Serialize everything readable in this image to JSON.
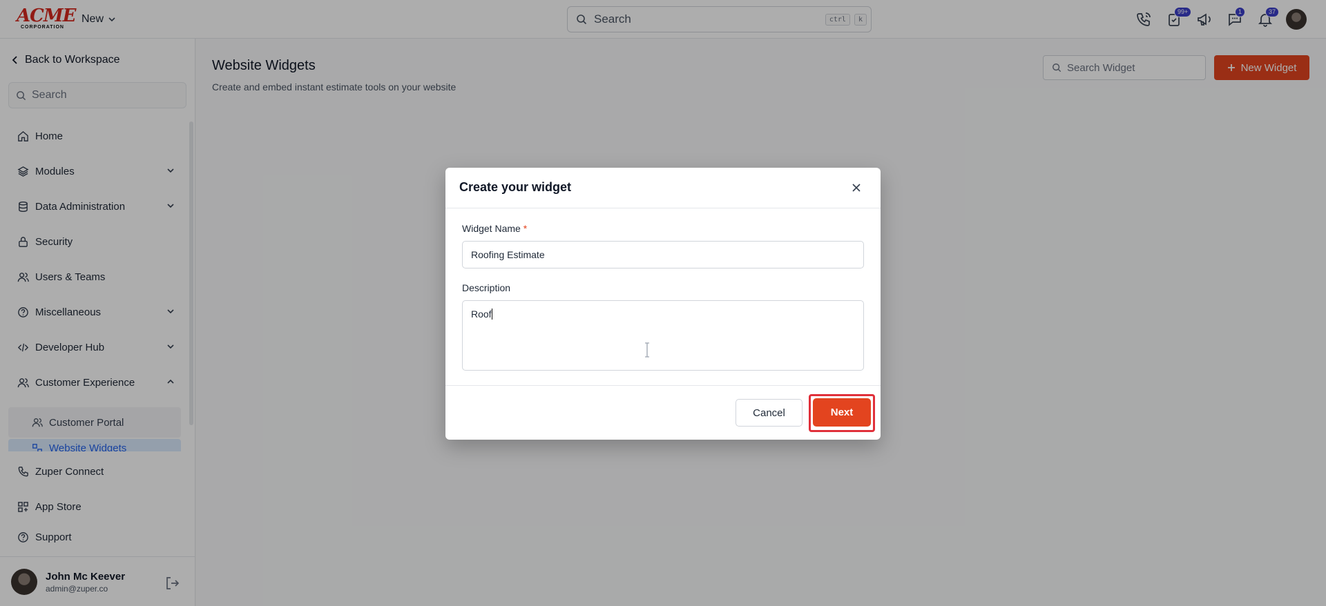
{
  "topbar": {
    "logo_text": "ACME",
    "logo_subtext": "CORPORATION",
    "new_label": "New",
    "search_placeholder": "Search",
    "kbd_ctrl": "ctrl",
    "kbd_k": "k",
    "badges": {
      "tasks": "99+",
      "chat": "1",
      "notifications": "37"
    }
  },
  "sidebar": {
    "back_label": "Back to Workspace",
    "search_placeholder": "Search",
    "items": [
      {
        "label": "Home",
        "icon": "home-icon"
      },
      {
        "label": "Modules",
        "icon": "layers-icon"
      },
      {
        "label": "Data Administration",
        "icon": "database-icon"
      },
      {
        "label": "Security",
        "icon": "lock-icon"
      },
      {
        "label": "Users & Teams",
        "icon": "users-icon"
      },
      {
        "label": "Miscellaneous",
        "icon": "help-circle-icon"
      },
      {
        "label": "Developer Hub",
        "icon": "code-icon"
      },
      {
        "label": "Customer Experience",
        "icon": "users-icon"
      }
    ],
    "subitems": [
      {
        "label": "Customer Portal"
      },
      {
        "label": "Website Widgets"
      }
    ],
    "bottom_items": [
      {
        "label": "Zuper Connect",
        "icon": "phone-icon"
      },
      {
        "label": "App Store",
        "icon": "grid-icon"
      },
      {
        "label": "Support",
        "icon": "help-circle-icon"
      }
    ],
    "user": {
      "name": "John Mc Keever",
      "email": "admin@zuper.co"
    }
  },
  "main": {
    "title": "Website Widgets",
    "subtitle": "Create and embed instant estimate tools on your website",
    "search_placeholder": "Search Widget",
    "new_widget_label": "New Widget"
  },
  "modal": {
    "title": "Create your widget",
    "name_label": "Widget Name",
    "name_required": "*",
    "name_value": "Roofing Estimate",
    "description_label": "Description",
    "description_value": "Roof",
    "cancel_label": "Cancel",
    "next_label": "Next"
  },
  "colors": {
    "accent": "#e3441f",
    "badge": "#3b3ec9",
    "highlight": "#e0303a"
  }
}
